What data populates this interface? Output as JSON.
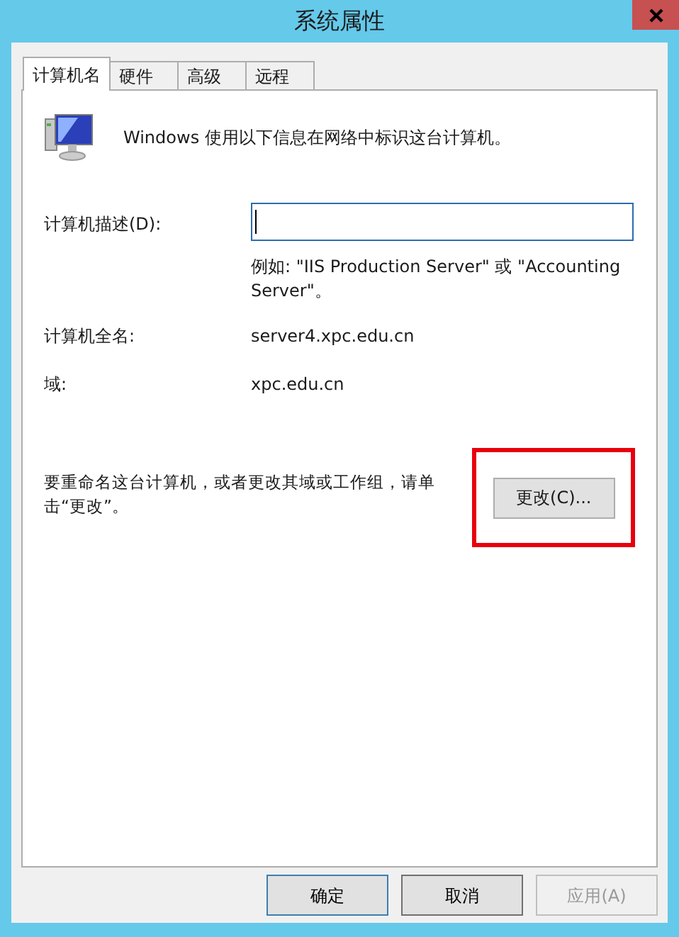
{
  "window": {
    "title": "系统属性"
  },
  "tabs": [
    {
      "label": "计算机名",
      "selected": true
    },
    {
      "label": "硬件",
      "selected": false
    },
    {
      "label": "高级",
      "selected": false
    },
    {
      "label": "远程",
      "selected": false
    }
  ],
  "intro": "Windows 使用以下信息在网络中标识这台计算机。",
  "description": {
    "label": "计算机描述(D):",
    "hint": "例如: \"IIS Production Server\" 或 \"Accounting Server\"。"
  },
  "fields": [
    {
      "label": "计算机全名:",
      "value": "server4.xpc.edu.cn"
    },
    {
      "label": "域:",
      "value": "xpc.edu.cn"
    }
  ],
  "rename": {
    "text": "要重命名这台计算机，或者更改其域或工作组，请单击“更改”。",
    "button": "更改(C)...",
    "highlighted": true
  },
  "buttons": [
    {
      "label": "确定",
      "disabled": false,
      "default": true
    },
    {
      "label": "取消",
      "disabled": false,
      "default": false
    },
    {
      "label": "应用(A)",
      "disabled": true,
      "default": false
    }
  ]
}
